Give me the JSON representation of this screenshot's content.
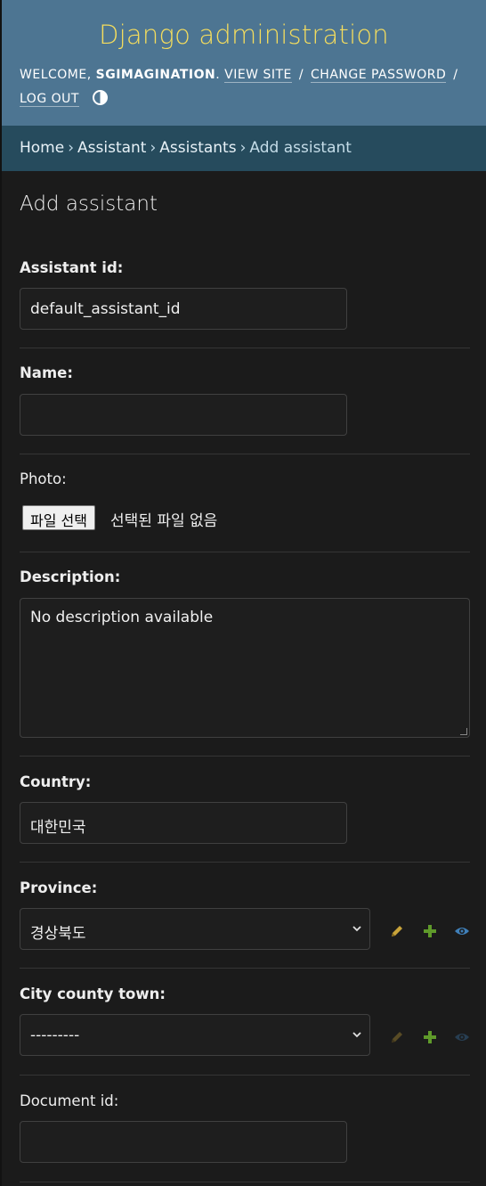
{
  "header": {
    "site_title": "Django administration",
    "welcome": "Welcome,",
    "username": "sgimagination",
    "view_site": "View site",
    "change_password": "Change password",
    "log_out": "Log out"
  },
  "breadcrumbs": {
    "home": "Home",
    "app": "Assistant",
    "model": "Assistants",
    "current": "Add assistant",
    "separator": "›"
  },
  "page": {
    "title": "Add assistant"
  },
  "form": {
    "assistant_id": {
      "label": "Assistant id:",
      "value": "default_assistant_id"
    },
    "name": {
      "label": "Name:",
      "value": ""
    },
    "photo": {
      "label": "Photo:",
      "button": "파일 선택",
      "status": "선택된 파일 없음"
    },
    "description": {
      "label": "Description:",
      "value": "No description available"
    },
    "country": {
      "label": "Country:",
      "value": "대한민국"
    },
    "province": {
      "label": "Province:",
      "selected": "경상북도"
    },
    "city_county_town": {
      "label": "City county town:",
      "selected": "---------"
    },
    "document_id": {
      "label": "Document id:",
      "value": ""
    }
  },
  "colors": {
    "header_bg": "#4d7592",
    "brand": "#f5dd5d",
    "breadcrumbs_bg": "#264b5d",
    "body_bg": "#1b1b1b",
    "edit_icon": "#c9a43a",
    "add_icon": "#5f9a2a",
    "view_icon": "#3f7fb8"
  },
  "icons": {
    "theme_toggle": "contrast-icon",
    "edit": "pencil-icon",
    "add": "plus-icon",
    "view": "eye-icon",
    "select_arrow": "chevron-down-icon"
  }
}
